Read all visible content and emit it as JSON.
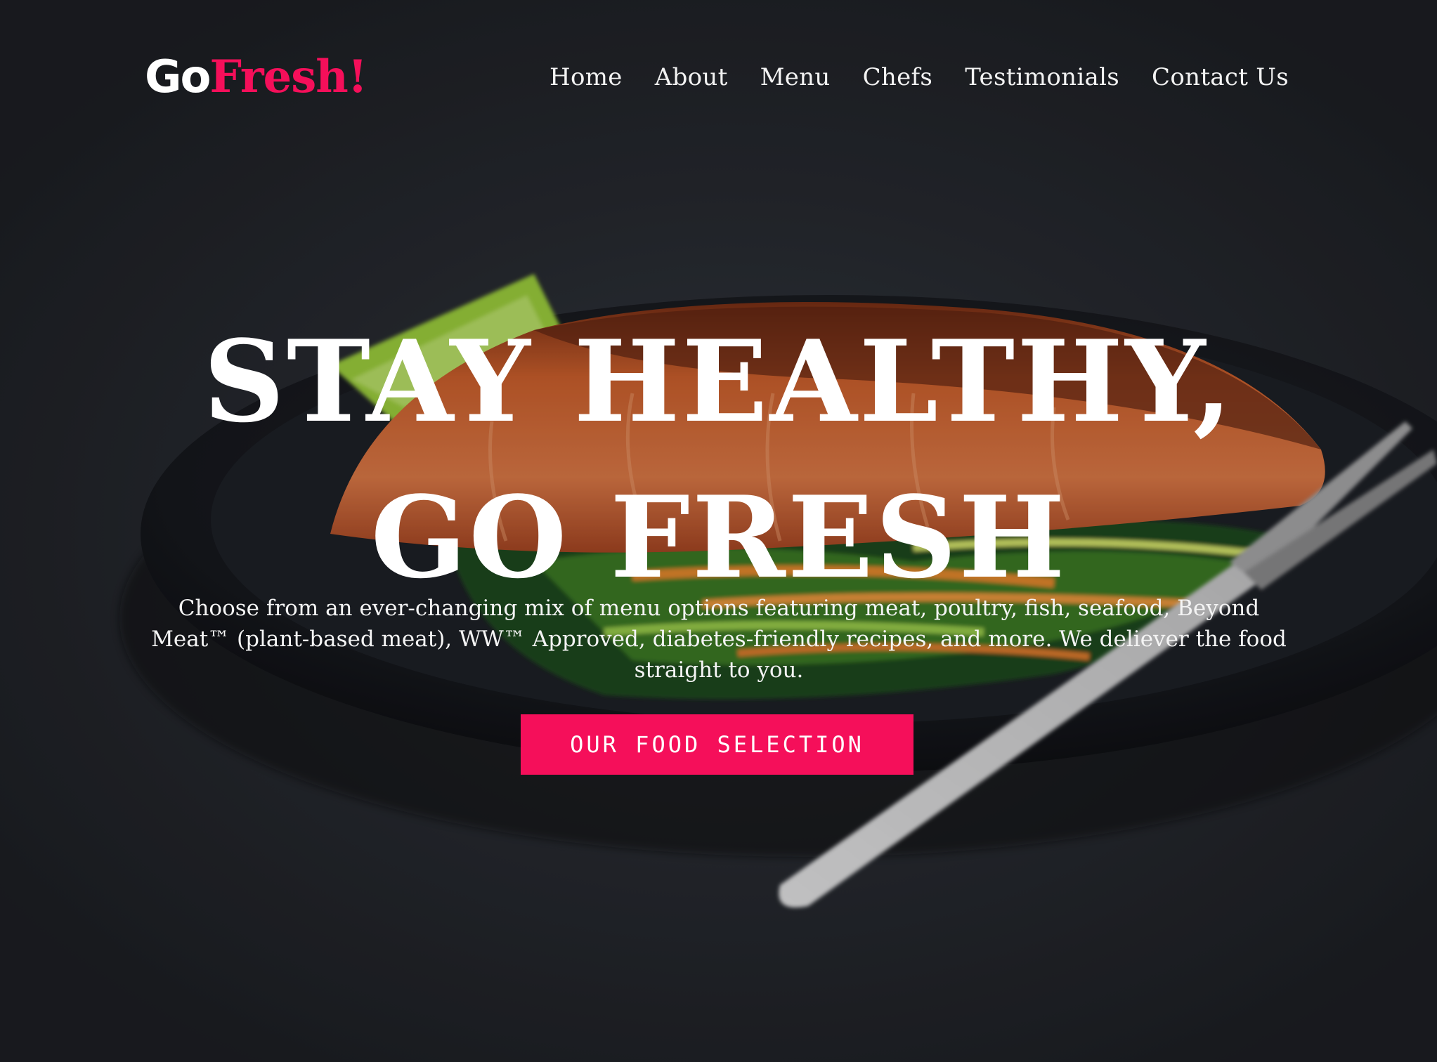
{
  "brand": {
    "logo_part1": "Go",
    "logo_part2": "Fresh!"
  },
  "nav": [
    {
      "label": "Home"
    },
    {
      "label": "About"
    },
    {
      "label": "Menu"
    },
    {
      "label": "Chefs"
    },
    {
      "label": "Testimonials"
    },
    {
      "label": "Contact Us"
    }
  ],
  "hero": {
    "title_line1": "STAY HEALTHY,",
    "title_line2": "GO FRESH",
    "description": "Choose from an ever-changing mix of menu options featuring meat, poultry, fish, seafood, Beyond Meat™ (plant-based meat), WW™ Approved, diabetes-friendly recipes, and more. We deliever the food straight to you.",
    "cta_label": "OUR FOOD SELECTION"
  },
  "colors": {
    "accent": "#f50f5a",
    "background": "#25282d",
    "text": "#ffffff"
  }
}
